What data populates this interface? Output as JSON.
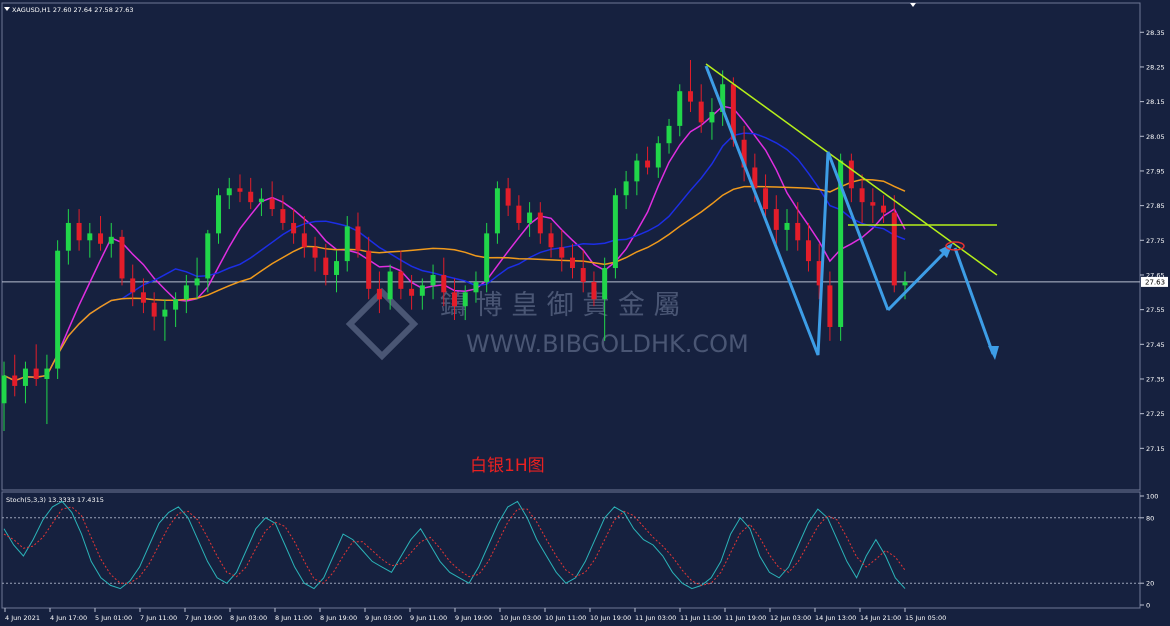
{
  "chart_data": [
    {
      "type": "candlestick",
      "header": "XAGUSD,H1  27.60 27.64 27.58 27.63",
      "symbol": "XAGUSD,H1",
      "ohlc_last": [
        27.6,
        27.64,
        27.58,
        27.63
      ],
      "annotation_label": "白银1H图",
      "watermark_text": "鑄 博 皇 御 貴 金 屬",
      "watermark_url": "WWW.BIBGOLDHK.COM",
      "current_price_label": "27.63",
      "current_price": 27.63,
      "ylim": [
        27.05,
        28.42
      ],
      "y_ticks": [
        "28.35",
        "28.25",
        "28.15",
        "28.05",
        "27.95",
        "27.85",
        "27.75",
        "27.65",
        "27.55",
        "27.45",
        "27.35",
        "27.25",
        "27.15"
      ],
      "x_ticks": [
        "4 Jun 2021",
        "4 Jun 17:00",
        "5 Jun 01:00",
        "7 Jun 11:00",
        "7 Jun 19:00",
        "8 Jun 03:00",
        "8 Jun 11:00",
        "8 Jun 19:00",
        "9 Jun 03:00",
        "9 Jun 11:00",
        "9 Jun 19:00",
        "10 Jun 03:00",
        "10 Jun 11:00",
        "10 Jun 19:00",
        "11 Jun 03:00",
        "11 Jun 11:00",
        "11 Jun 19:00",
        "12 Jun 03:00",
        "14 Jun 13:00",
        "14 Jun 21:00",
        "15 Jun 05:00"
      ],
      "candles": [
        [
          27.28,
          27.4,
          27.2,
          27.36
        ],
        [
          27.36,
          27.42,
          27.3,
          27.33
        ],
        [
          27.33,
          27.4,
          27.28,
          27.38
        ],
        [
          27.38,
          27.45,
          27.33,
          27.35
        ],
        [
          27.35,
          27.42,
          27.22,
          27.38
        ],
        [
          27.38,
          27.75,
          27.35,
          27.72
        ],
        [
          27.72,
          27.84,
          27.68,
          27.8
        ],
        [
          27.8,
          27.84,
          27.72,
          27.75
        ],
        [
          27.75,
          27.8,
          27.7,
          27.77
        ],
        [
          27.77,
          27.82,
          27.72,
          27.74
        ],
        [
          27.74,
          27.8,
          27.7,
          27.76
        ],
        [
          27.76,
          27.78,
          27.62,
          27.64
        ],
        [
          27.64,
          27.68,
          27.56,
          27.6
        ],
        [
          27.6,
          27.64,
          27.54,
          27.57
        ],
        [
          27.57,
          27.6,
          27.49,
          27.53
        ],
        [
          27.53,
          27.58,
          27.46,
          27.55
        ],
        [
          27.55,
          27.6,
          27.5,
          27.58
        ],
        [
          27.58,
          27.65,
          27.54,
          27.62
        ],
        [
          27.62,
          27.7,
          27.58,
          27.64
        ],
        [
          27.64,
          27.78,
          27.6,
          27.77
        ],
        [
          27.77,
          27.9,
          27.74,
          27.88
        ],
        [
          27.88,
          27.93,
          27.84,
          27.9
        ],
        [
          27.9,
          27.94,
          27.86,
          27.89
        ],
        [
          27.89,
          27.93,
          27.84,
          27.86
        ],
        [
          27.86,
          27.9,
          27.82,
          27.87
        ],
        [
          27.87,
          27.92,
          27.82,
          27.84
        ],
        [
          27.84,
          27.88,
          27.78,
          27.8
        ],
        [
          27.8,
          27.84,
          27.74,
          27.77
        ],
        [
          27.77,
          27.82,
          27.7,
          27.73
        ],
        [
          27.73,
          27.76,
          27.66,
          27.7
        ],
        [
          27.7,
          27.74,
          27.62,
          27.65
        ],
        [
          27.65,
          27.72,
          27.6,
          27.69
        ],
        [
          27.69,
          27.82,
          27.66,
          27.79
        ],
        [
          27.79,
          27.83,
          27.7,
          27.72
        ],
        [
          27.72,
          27.76,
          27.58,
          27.61
        ],
        [
          27.61,
          27.66,
          27.54,
          27.58
        ],
        [
          27.58,
          27.68,
          27.55,
          27.66
        ],
        [
          27.66,
          27.72,
          27.58,
          27.61
        ],
        [
          27.61,
          27.65,
          27.55,
          27.59
        ],
        [
          27.59,
          27.64,
          27.55,
          27.62
        ],
        [
          27.62,
          27.68,
          27.58,
          27.65
        ],
        [
          27.65,
          27.7,
          27.56,
          27.6
        ],
        [
          27.6,
          27.64,
          27.52,
          27.56
        ],
        [
          27.56,
          27.62,
          27.52,
          27.6
        ],
        [
          27.6,
          27.66,
          27.57,
          27.63
        ],
        [
          27.63,
          27.8,
          27.6,
          27.77
        ],
        [
          27.77,
          27.92,
          27.74,
          27.9
        ],
        [
          27.9,
          27.93,
          27.82,
          27.85
        ],
        [
          27.85,
          27.88,
          27.78,
          27.8
        ],
        [
          27.8,
          27.86,
          27.76,
          27.83
        ],
        [
          27.83,
          27.86,
          27.74,
          27.77
        ],
        [
          27.77,
          27.8,
          27.7,
          27.73
        ],
        [
          27.73,
          27.78,
          27.66,
          27.7
        ],
        [
          27.7,
          27.74,
          27.64,
          27.67
        ],
        [
          27.67,
          27.72,
          27.6,
          27.63
        ],
        [
          27.63,
          27.66,
          27.56,
          27.58
        ],
        [
          27.58,
          27.7,
          27.46,
          27.67
        ],
        [
          27.67,
          27.9,
          27.64,
          27.88
        ],
        [
          27.88,
          27.95,
          27.84,
          27.92
        ],
        [
          27.92,
          28.0,
          27.88,
          27.98
        ],
        [
          27.98,
          28.02,
          27.94,
          27.96
        ],
        [
          27.96,
          28.05,
          27.93,
          28.03
        ],
        [
          28.03,
          28.1,
          28.0,
          28.08
        ],
        [
          28.08,
          28.2,
          28.05,
          28.18
        ],
        [
          28.18,
          28.27,
          28.12,
          28.15
        ],
        [
          28.15,
          28.2,
          28.06,
          28.09
        ],
        [
          28.09,
          28.16,
          28.04,
          28.12
        ],
        [
          28.12,
          28.24,
          28.08,
          28.2
        ],
        [
          28.2,
          28.22,
          28.02,
          28.04
        ],
        [
          28.04,
          28.08,
          27.92,
          27.96
        ],
        [
          27.96,
          28.0,
          27.86,
          27.9
        ],
        [
          27.9,
          27.94,
          27.8,
          27.84
        ],
        [
          27.84,
          27.88,
          27.74,
          27.78
        ],
        [
          27.78,
          27.84,
          27.72,
          27.8
        ],
        [
          27.8,
          27.86,
          27.72,
          27.75
        ],
        [
          27.75,
          27.8,
          27.66,
          27.69
        ],
        [
          27.69,
          27.74,
          27.58,
          27.62
        ],
        [
          27.62,
          27.66,
          27.46,
          27.5
        ],
        [
          27.5,
          28.0,
          27.46,
          27.98
        ],
        [
          27.98,
          28.0,
          27.86,
          27.9
        ],
        [
          27.9,
          27.94,
          27.8,
          27.86
        ],
        [
          27.86,
          27.9,
          27.8,
          27.85
        ],
        [
          27.85,
          27.88,
          27.8,
          27.83
        ],
        [
          27.83,
          27.88,
          27.6,
          27.62
        ],
        [
          27.62,
          27.66,
          27.58,
          27.63
        ]
      ],
      "stoch_label": "Stoch(5,3,3) 13.3333 17.4315",
      "stoch_ylim": [
        0,
        100
      ],
      "stoch_ticks": [
        "100",
        "80",
        "20",
        "0"
      ],
      "stoch_levels": [
        80,
        20
      ],
      "stoch_k": [
        70,
        55,
        45,
        60,
        78,
        90,
        95,
        85,
        65,
        40,
        25,
        18,
        15,
        22,
        35,
        55,
        75,
        85,
        90,
        80,
        60,
        40,
        25,
        20,
        30,
        50,
        70,
        80,
        75,
        55,
        35,
        20,
        15,
        25,
        45,
        65,
        60,
        50,
        40,
        35,
        30,
        45,
        60,
        70,
        55,
        40,
        30,
        25,
        20,
        35,
        55,
        75,
        90,
        95,
        80,
        60,
        45,
        30,
        20,
        25,
        40,
        60,
        80,
        90,
        85,
        70,
        60,
        55,
        45,
        30,
        20,
        15,
        18,
        25,
        40,
        65,
        80,
        70,
        45,
        30,
        25,
        35,
        55,
        75,
        88,
        80,
        60,
        40,
        25,
        45,
        60,
        45,
        25,
        15
      ],
      "stoch_d": [
        65,
        60,
        52,
        54,
        62,
        75,
        88,
        90,
        82,
        62,
        42,
        28,
        20,
        20,
        26,
        38,
        55,
        72,
        84,
        86,
        78,
        62,
        45,
        30,
        26,
        35,
        52,
        68,
        76,
        72,
        58,
        40,
        24,
        20,
        30,
        45,
        58,
        58,
        50,
        42,
        36,
        38,
        48,
        58,
        62,
        52,
        40,
        32,
        26,
        28,
        40,
        58,
        76,
        88,
        88,
        76,
        60,
        45,
        32,
        26,
        30,
        42,
        60,
        78,
        86,
        82,
        72,
        62,
        54,
        44,
        32,
        22,
        18,
        20,
        30,
        48,
        66,
        74,
        62,
        46,
        34,
        30,
        40,
        56,
        72,
        82,
        78,
        62,
        44,
        35,
        42,
        50,
        44,
        32
      ]
    }
  ]
}
